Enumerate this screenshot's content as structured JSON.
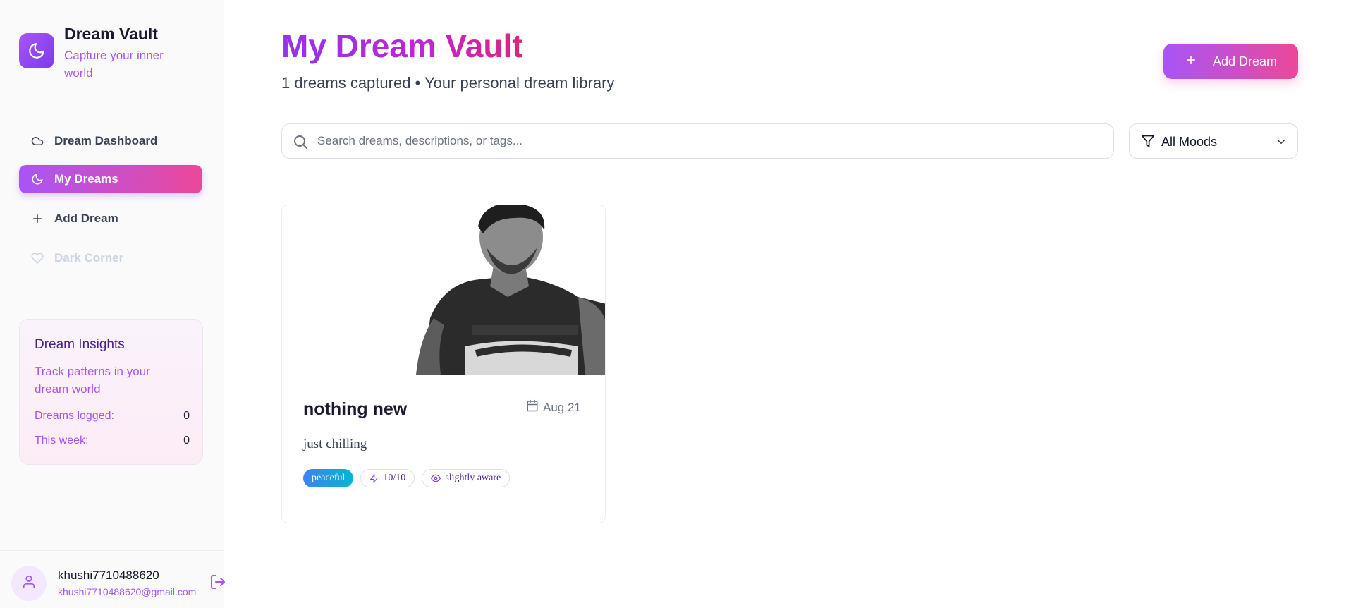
{
  "brand": {
    "title": "Dream Vault",
    "subtitle": "Capture your inner world",
    "logo_icon": "moon-icon"
  },
  "nav": {
    "items": [
      {
        "label": "Dream Dashboard",
        "icon": "cloud-icon",
        "state": "normal"
      },
      {
        "label": "My Dreams",
        "icon": "moon-icon",
        "state": "active"
      },
      {
        "label": "Add Dream",
        "icon": "plus-icon",
        "state": "normal"
      },
      {
        "label": "Dark Corner",
        "icon": "heart-icon",
        "state": "disabled"
      }
    ]
  },
  "insights": {
    "title": "Dream Insights",
    "description": "Track patterns in your dream world",
    "rows": [
      {
        "label": "Dreams logged:",
        "value": "0"
      },
      {
        "label": "This week:",
        "value": "0"
      }
    ]
  },
  "user": {
    "name": "khushi7710488620",
    "email": "khushi7710488620@gmail.com",
    "avatar_icon": "user-icon",
    "logout_icon": "logout-icon"
  },
  "main": {
    "title": "My Dream Vault",
    "subtitle": "1 dreams captured • Your personal dream library",
    "add_button_label": "Add Dream",
    "search_placeholder": "Search dreams, descriptions, or tags...",
    "mood_filter_value": "All Moods"
  },
  "dreams": [
    {
      "title": "nothing new",
      "date": "Aug 21",
      "description": "just chilling",
      "mood": "peaceful",
      "intensity": "10/10",
      "lucidity": "slightly aware"
    }
  ],
  "colors": {
    "accent_purple": "#a855f7",
    "accent_pink": "#ec4899",
    "mood_blue": "#3b82f6",
    "mood_cyan": "#06b6d4"
  }
}
